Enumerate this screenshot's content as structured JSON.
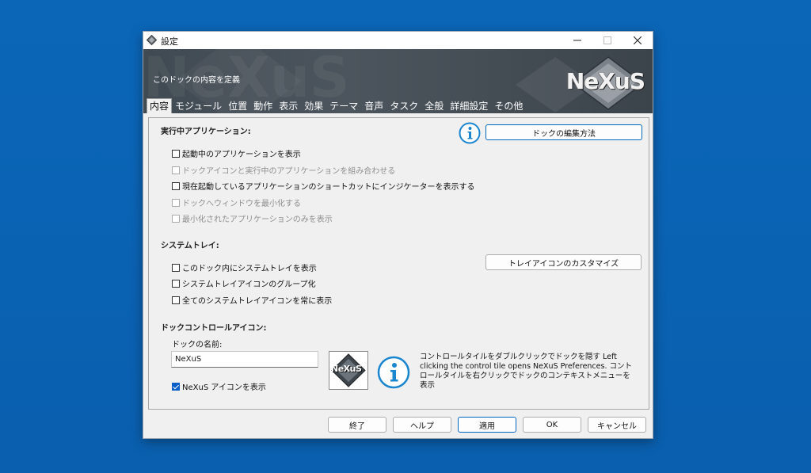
{
  "window": {
    "title": "設定",
    "icon": "nexus-diamond-icon",
    "minimize_icon": "minimize-icon",
    "maximize_icon": "maximize-icon",
    "close_icon": "close-icon"
  },
  "banner": {
    "description": "このドックの内容を定義",
    "logo": "NeXuS"
  },
  "tabs": [
    {
      "label": "内容",
      "active": true
    },
    {
      "label": "モジュール"
    },
    {
      "label": "位置"
    },
    {
      "label": "動作"
    },
    {
      "label": "表示"
    },
    {
      "label": "効果"
    },
    {
      "label": "テーマ"
    },
    {
      "label": "音声"
    },
    {
      "label": "タスク"
    },
    {
      "label": "全般"
    },
    {
      "label": "詳細設定"
    },
    {
      "label": "その他"
    }
  ],
  "running_apps": {
    "title": "実行中アプリケーション:",
    "edit_button": "ドックの編集方法",
    "options": [
      {
        "label": "起動中のアプリケーションを表示",
        "checked": false,
        "enabled": true
      },
      {
        "label": "ドックアイコンと実行中のアプリケーションを組み合わせる",
        "checked": false,
        "enabled": false
      },
      {
        "label": "現在起動しているアプリケーションのショートカットにインジケーターを表示する",
        "checked": false,
        "enabled": true
      },
      {
        "label": "ドックへウィンドウを最小化する",
        "checked": false,
        "enabled": false
      },
      {
        "label": "最小化されたアプリケーションのみを表示",
        "checked": false,
        "enabled": false
      }
    ]
  },
  "system_tray": {
    "title": "システムトレイ:",
    "customize_button": "トレイアイコンのカスタマイズ",
    "options": [
      {
        "label": "このドック内にシステムトレイを表示",
        "checked": false,
        "enabled": true
      },
      {
        "label": "システムトレイアイコンのグループ化",
        "checked": false,
        "enabled": true
      },
      {
        "label": "全てのシステムトレイアイコンを常に表示",
        "checked": false,
        "enabled": true
      }
    ]
  },
  "dock_control": {
    "title": "ドックコントロールアイコン:",
    "name_label": "ドックの名前:",
    "name_value": "NeXuS",
    "show_icon_label": "NeXuS アイコンを表示",
    "show_icon_checked": true,
    "tile_logo": "NeXuS",
    "description": "コントロールタイルをダブルクリックでドックを隠す Left clicking the control tile opens NeXuS Preferences. コントロールタイルを右クリックでドックのコンテキストメニューを表示"
  },
  "footer": {
    "buttons": [
      "終了",
      "ヘルプ",
      "適用",
      "OK",
      "キャンセル"
    ]
  },
  "colors": {
    "desktop": "#0a64b4",
    "banner": "#454e56",
    "info_blue": "#1a86d0",
    "accent": "#0067c0"
  }
}
